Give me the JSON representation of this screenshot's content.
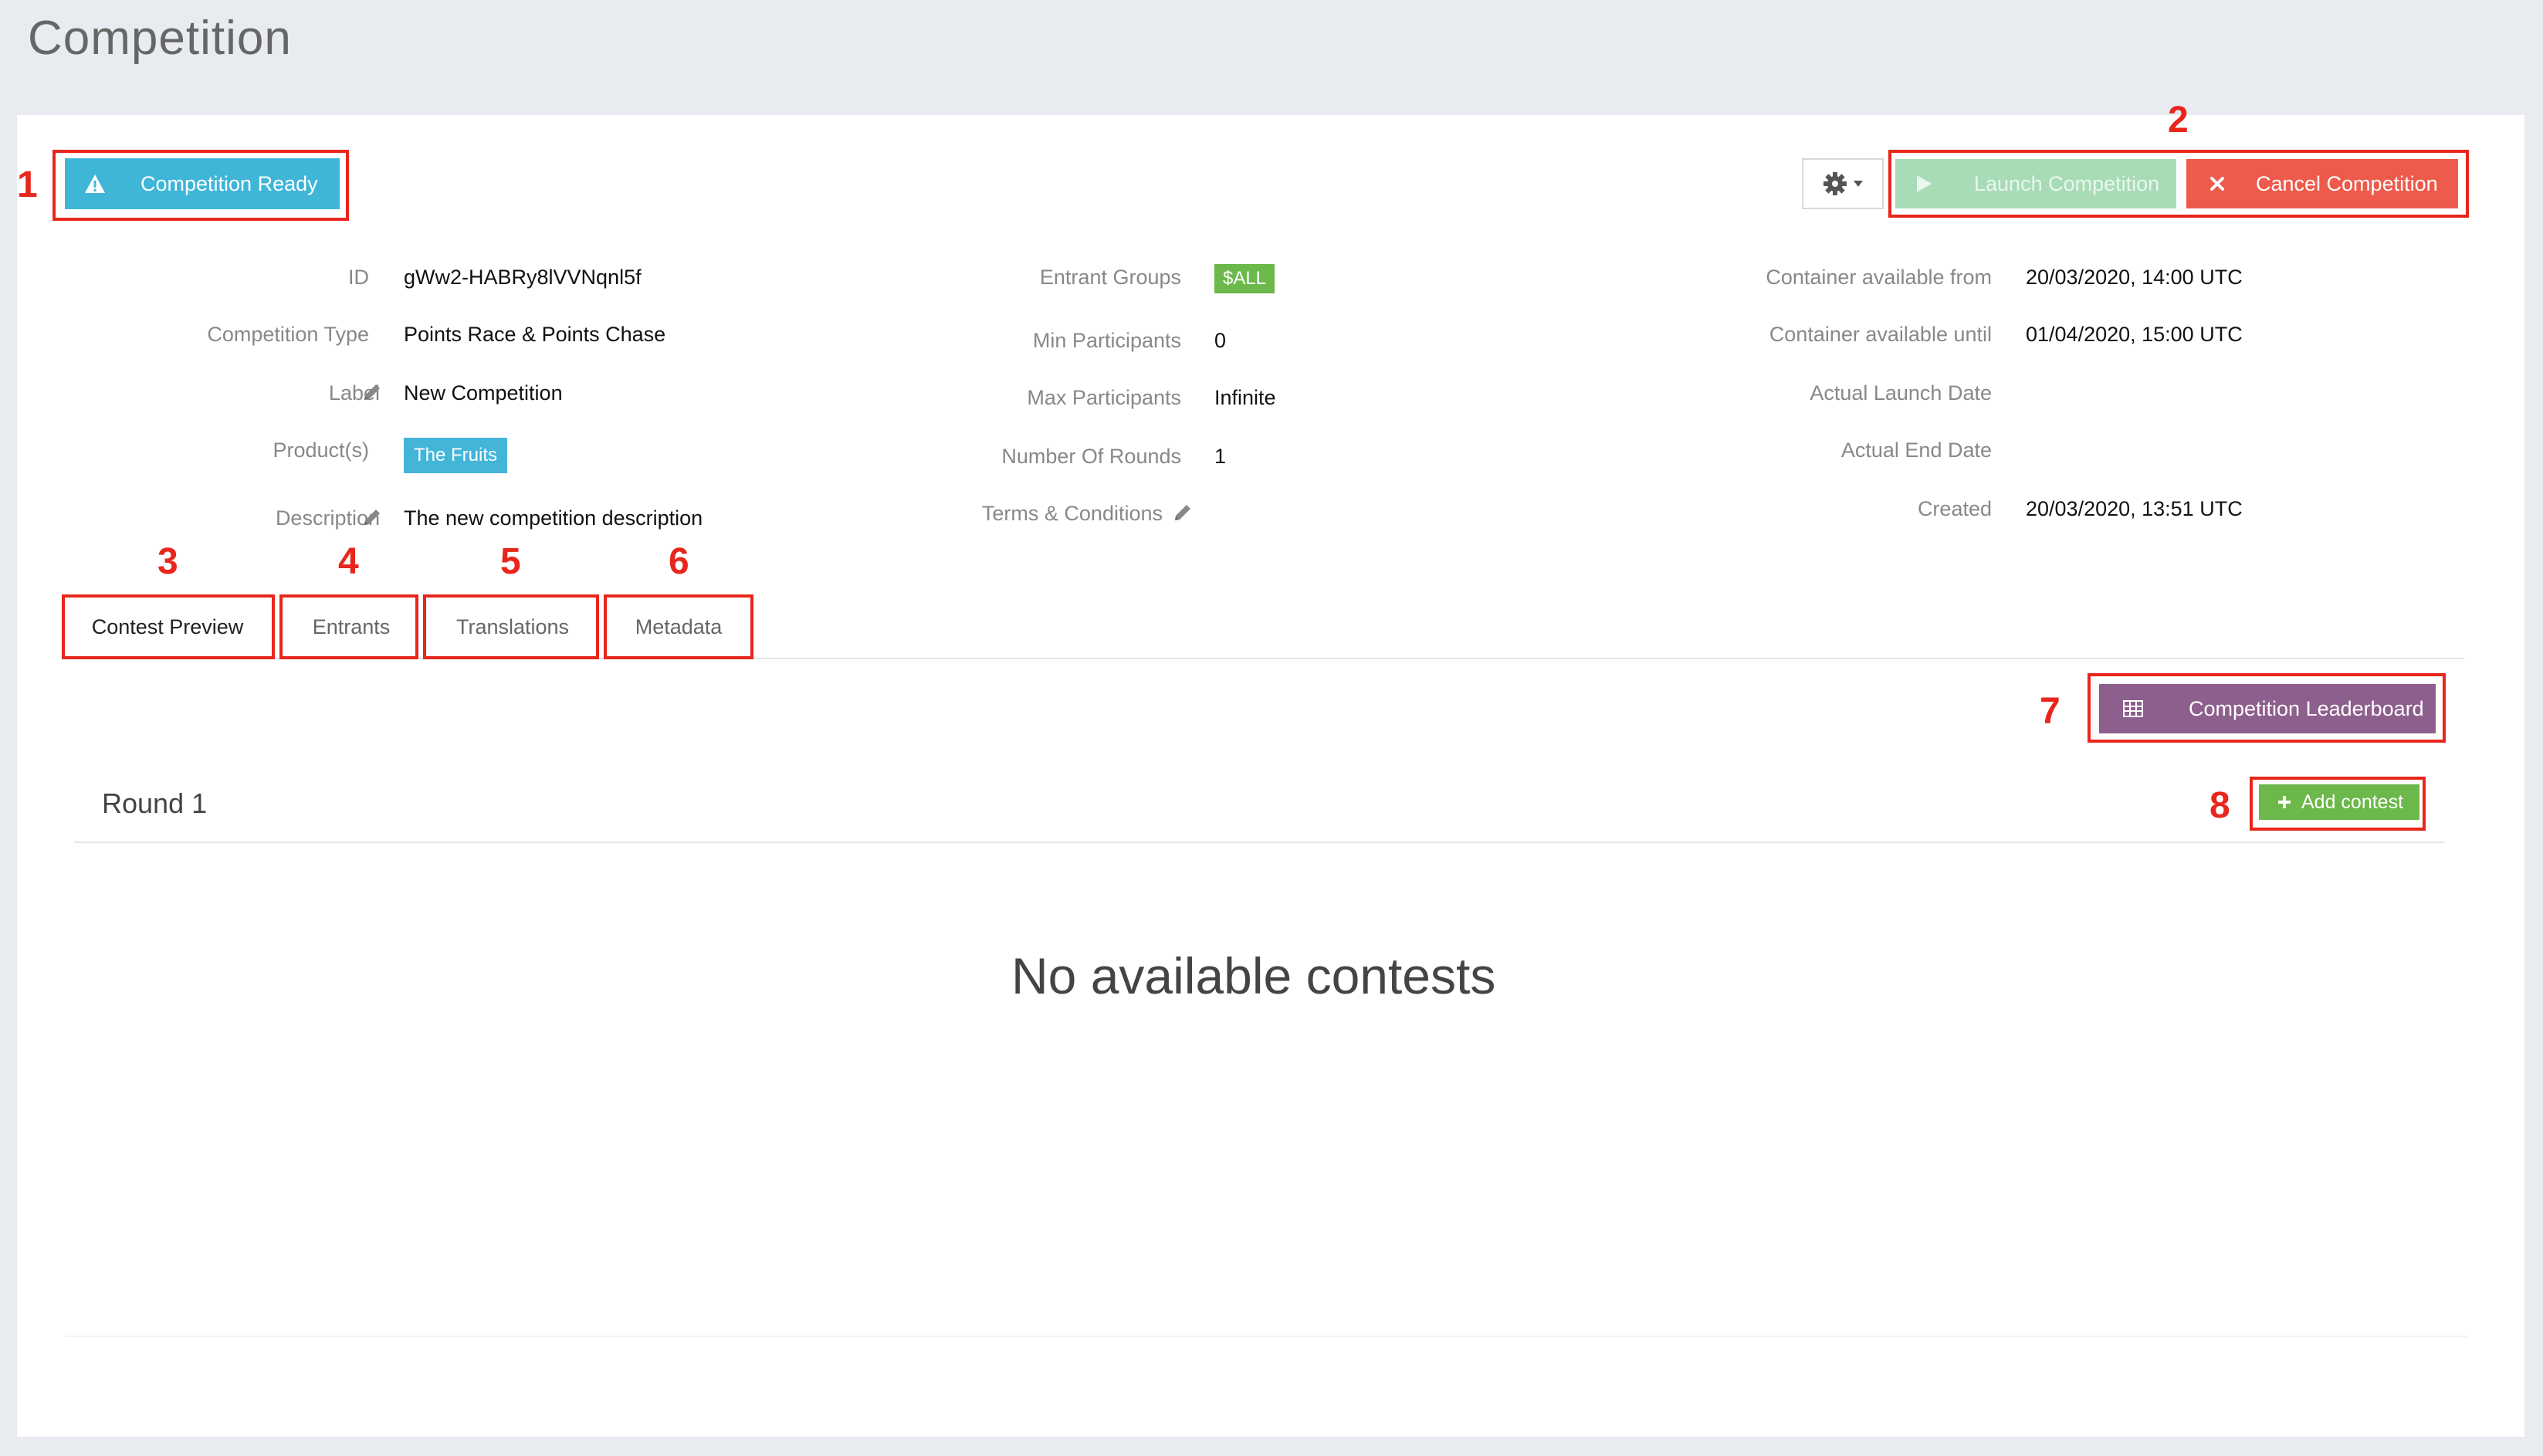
{
  "page": {
    "title": "Competition"
  },
  "toolbar": {
    "status_label": "Competition Ready",
    "launch_label": "Launch Competition",
    "cancel_label": "Cancel Competition"
  },
  "details": {
    "col1": [
      {
        "label": "ID",
        "value": "gWw2-HABRy8lVVNqnl5f"
      },
      {
        "label": "Competition Type",
        "value": "Points Race & Points Chase"
      },
      {
        "label": "Label",
        "value": "New Competition"
      },
      {
        "label": "Product(s)",
        "value": "The Fruits"
      },
      {
        "label": "Description",
        "value": "The new competition description"
      }
    ],
    "col2": [
      {
        "label": "Entrant Groups",
        "value": "$ALL"
      },
      {
        "label": "Min Participants",
        "value": "0"
      },
      {
        "label": "Max Participants",
        "value": "Infinite"
      },
      {
        "label": "Number Of Rounds",
        "value": "1"
      },
      {
        "label": "Terms & Conditions",
        "value": ""
      }
    ],
    "col3": [
      {
        "label": "Container available from",
        "value": "20/03/2020, 14:00 UTC"
      },
      {
        "label": "Container available until",
        "value": "01/04/2020, 15:00 UTC"
      },
      {
        "label": "Actual Launch Date",
        "value": ""
      },
      {
        "label": "Actual End Date",
        "value": ""
      },
      {
        "label": "Created",
        "value": "20/03/2020, 13:51 UTC"
      }
    ]
  },
  "tabs": [
    {
      "label": "Contest Preview",
      "active": true
    },
    {
      "label": "Entrants",
      "active": false
    },
    {
      "label": "Translations",
      "active": false
    },
    {
      "label": "Metadata",
      "active": false
    }
  ],
  "leaderboard_label": "Competition Leaderboard",
  "round": {
    "title": "Round 1",
    "add_label": "Add contest"
  },
  "empty_message": "No available contests",
  "annotations": [
    "1",
    "2",
    "3",
    "4",
    "5",
    "6",
    "7",
    "8"
  ],
  "colors": {
    "annotation": "#e8261c",
    "ready": "#3fb5d8",
    "launch": "#a7dcb7",
    "cancel": "#ee5a4b",
    "leaderboard": "#8d5f8c",
    "add": "#6cb84a"
  },
  "icons": {
    "ready": "warning-icon",
    "gear": "gear-icon",
    "launch": "play-icon",
    "cancel": "close-icon",
    "leaderboard": "table-icon",
    "add": "plus-icon",
    "edit": "pencil-icon"
  }
}
